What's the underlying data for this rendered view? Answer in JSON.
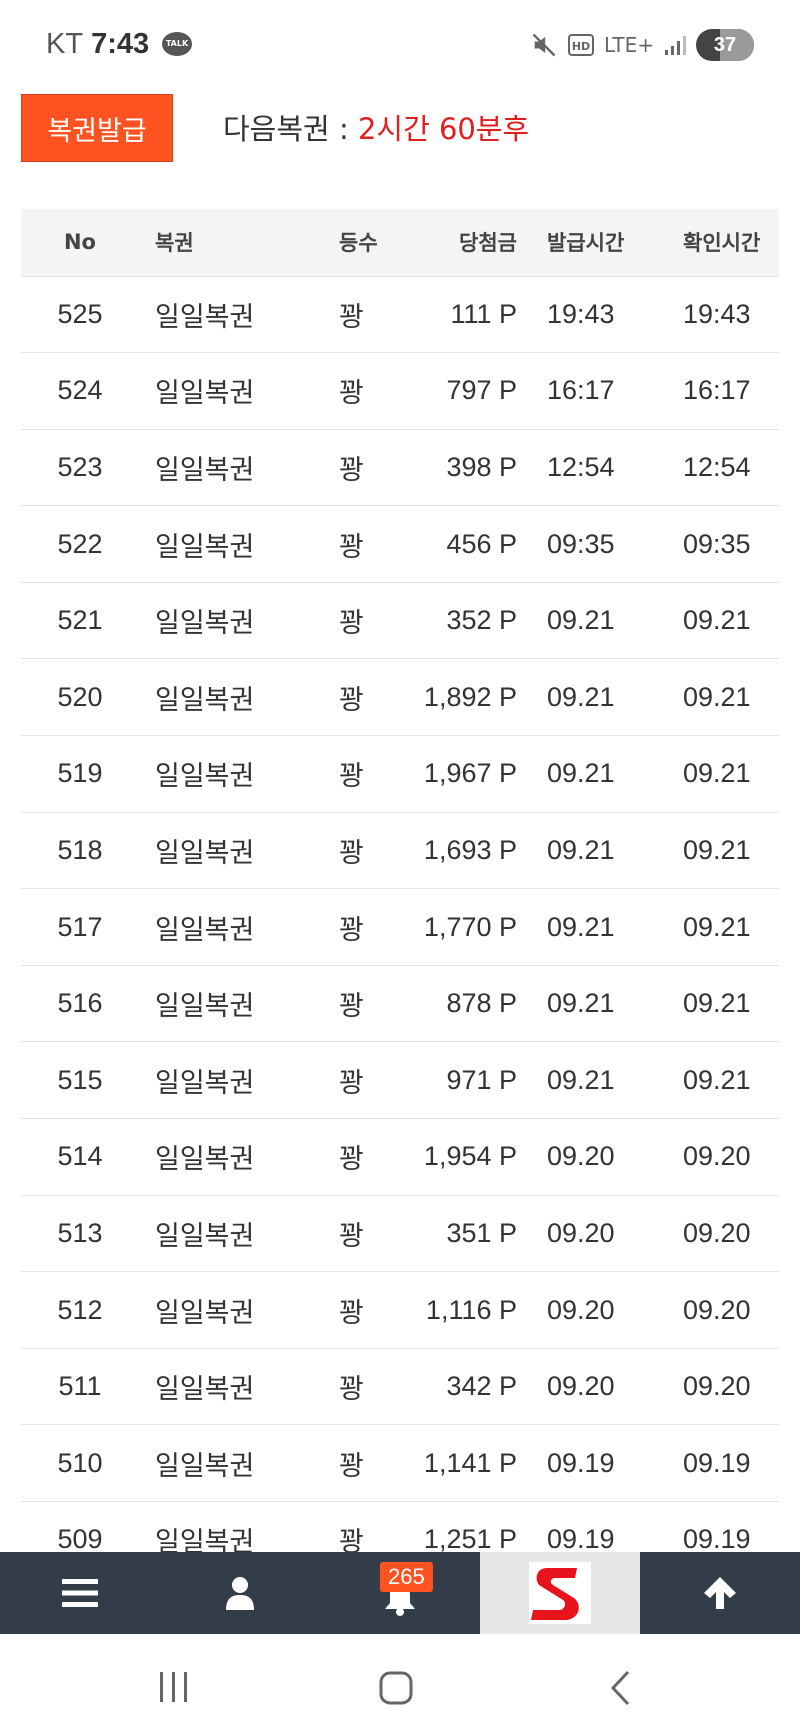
{
  "status_bar": {
    "carrier": "KT",
    "time": "7:43",
    "talk_label": "TALK",
    "network": "LTE+",
    "battery": "37"
  },
  "header": {
    "issue_button": "복권발급",
    "next_label": "다음복권 : ",
    "next_value": "2시간 60분후"
  },
  "table": {
    "columns": [
      "No",
      "복권",
      "등수",
      "당첨금",
      "발급시간",
      "확인시간"
    ],
    "rows": [
      {
        "no": "525",
        "name": "일일복권",
        "rank": "꽝",
        "prize": "111 P",
        "issued": "19:43",
        "checked": "19:43"
      },
      {
        "no": "524",
        "name": "일일복권",
        "rank": "꽝",
        "prize": "797 P",
        "issued": "16:17",
        "checked": "16:17"
      },
      {
        "no": "523",
        "name": "일일복권",
        "rank": "꽝",
        "prize": "398 P",
        "issued": "12:54",
        "checked": "12:54"
      },
      {
        "no": "522",
        "name": "일일복권",
        "rank": "꽝",
        "prize": "456 P",
        "issued": "09:35",
        "checked": "09:35"
      },
      {
        "no": "521",
        "name": "일일복권",
        "rank": "꽝",
        "prize": "352 P",
        "issued": "09.21",
        "checked": "09.21"
      },
      {
        "no": "520",
        "name": "일일복권",
        "rank": "꽝",
        "prize": "1,892 P",
        "issued": "09.21",
        "checked": "09.21"
      },
      {
        "no": "519",
        "name": "일일복권",
        "rank": "꽝",
        "prize": "1,967 P",
        "issued": "09.21",
        "checked": "09.21"
      },
      {
        "no": "518",
        "name": "일일복권",
        "rank": "꽝",
        "prize": "1,693 P",
        "issued": "09.21",
        "checked": "09.21"
      },
      {
        "no": "517",
        "name": "일일복권",
        "rank": "꽝",
        "prize": "1,770 P",
        "issued": "09.21",
        "checked": "09.21"
      },
      {
        "no": "516",
        "name": "일일복권",
        "rank": "꽝",
        "prize": "878 P",
        "issued": "09.21",
        "checked": "09.21"
      },
      {
        "no": "515",
        "name": "일일복권",
        "rank": "꽝",
        "prize": "971 P",
        "issued": "09.21",
        "checked": "09.21"
      },
      {
        "no": "514",
        "name": "일일복권",
        "rank": "꽝",
        "prize": "1,954 P",
        "issued": "09.20",
        "checked": "09.20"
      },
      {
        "no": "513",
        "name": "일일복권",
        "rank": "꽝",
        "prize": "351 P",
        "issued": "09.20",
        "checked": "09.20"
      },
      {
        "no": "512",
        "name": "일일복권",
        "rank": "꽝",
        "prize": "1,116 P",
        "issued": "09.20",
        "checked": "09.20"
      },
      {
        "no": "511",
        "name": "일일복권",
        "rank": "꽝",
        "prize": "342 P",
        "issued": "09.20",
        "checked": "09.20"
      },
      {
        "no": "510",
        "name": "일일복권",
        "rank": "꽝",
        "prize": "1,141 P",
        "issued": "09.19",
        "checked": "09.19"
      },
      {
        "no": "509",
        "name": "일일복권",
        "rank": "꽝",
        "prize": "1,251 P",
        "issued": "09.19",
        "checked": "09.19"
      }
    ]
  },
  "bottom_nav": {
    "notification_count": "265",
    "items": [
      "menu-icon",
      "user-icon",
      "bell-icon",
      "site-logo",
      "arrow-up-icon"
    ],
    "logo_letter": "S",
    "colors": {
      "bar": "#333d49",
      "accent": "#ff5221",
      "logo": "#e8141c"
    }
  }
}
